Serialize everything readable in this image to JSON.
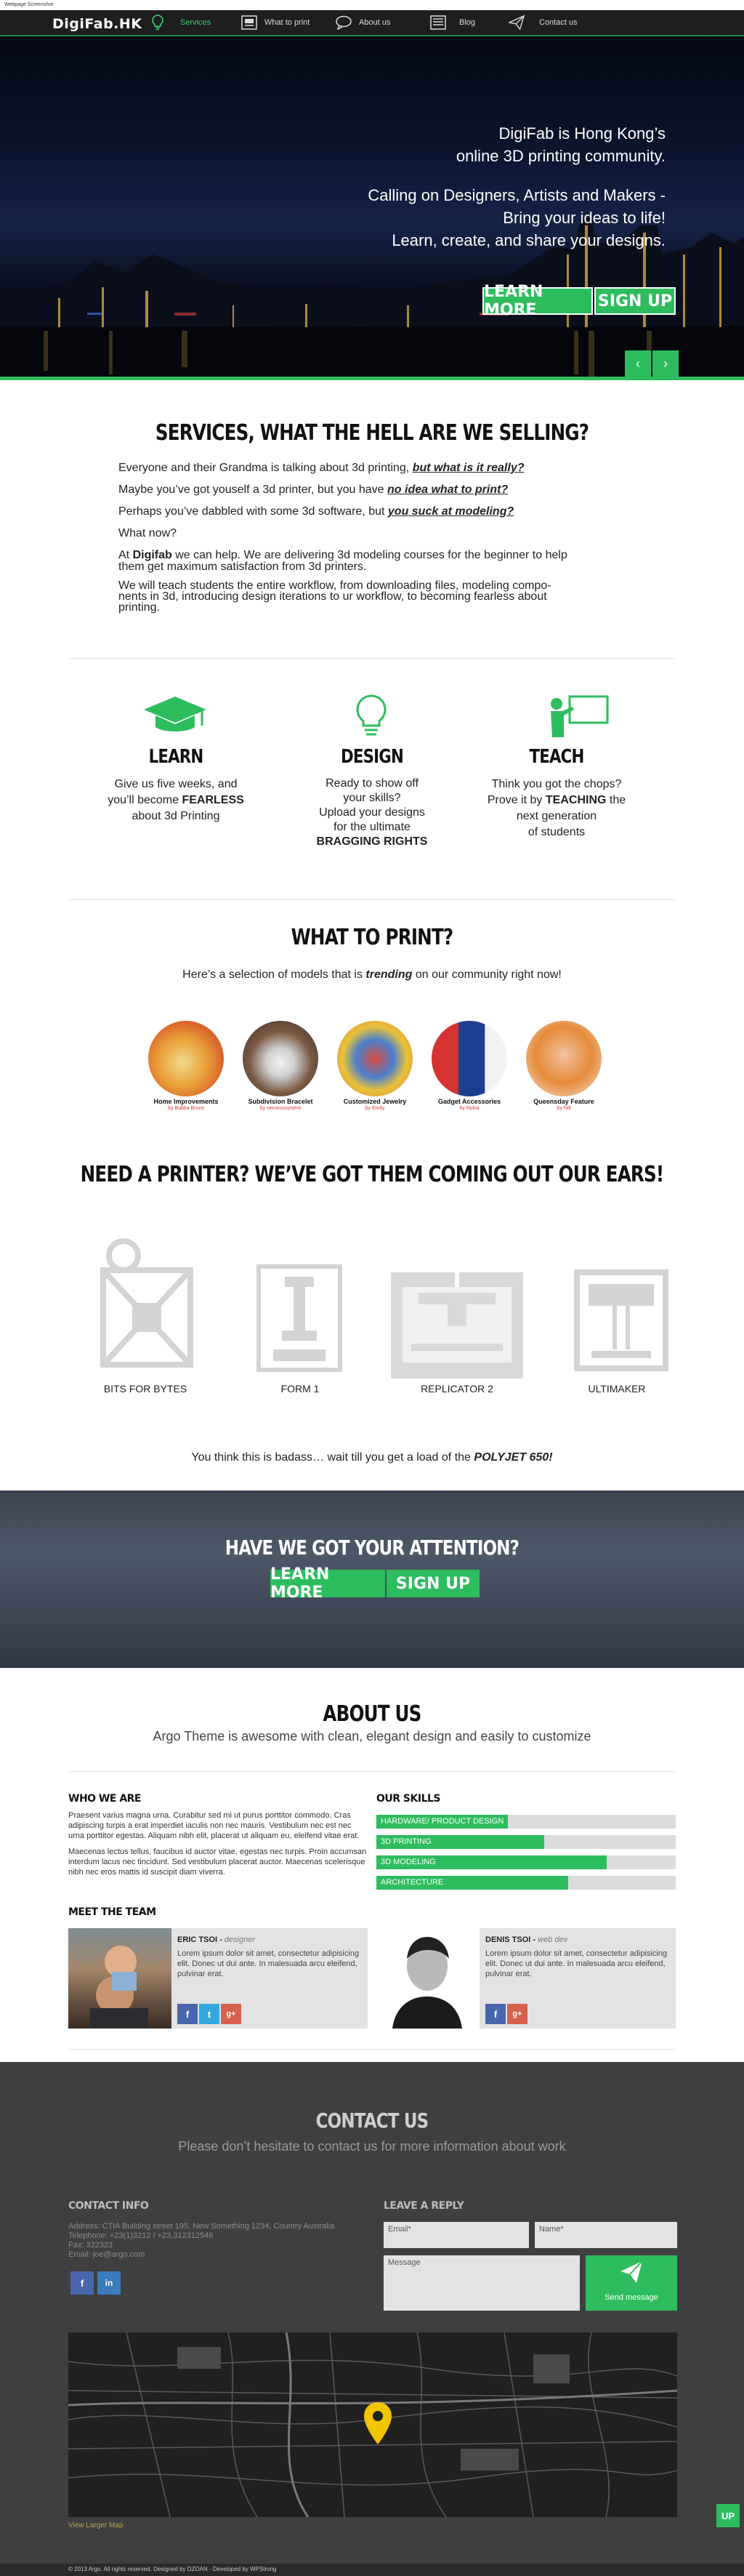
{
  "screenshot_label": "Webpage Screenshot",
  "nav": {
    "logo": "DigiFab.HK",
    "items": [
      {
        "label": "Services",
        "icon": "lightbulb-icon"
      },
      {
        "label": "What to print",
        "icon": "printer-icon"
      },
      {
        "label": "About us",
        "icon": "speech-bubble-icon"
      },
      {
        "label": "Blog",
        "icon": "newspaper-icon"
      },
      {
        "label": "Contact us",
        "icon": "paper-plane-icon"
      }
    ]
  },
  "hero": {
    "line1": "DigiFab is Hong Kong’s",
    "line2": "online 3D printing community.",
    "line3": "Calling on Designers, Artists and Makers -",
    "line4": "Bring your ideas to life!",
    "line5": "Learn, create, and share your designs.",
    "btn_learn": "LEARN MORE",
    "btn_signup": "SIGN UP",
    "prev": "‹",
    "next": "›"
  },
  "services": {
    "title": "SERVICES, WHAT THE HELL ARE WE SELLING?",
    "p1_a": "Everyone and their Grandma is talking about 3d printing,",
    "p1_b": "but what is it really?",
    "p2_a": "Maybe you’ve got youself a 3d printer, but you have",
    "p2_b": "no idea what to print?",
    "p3_a": "Perhaps you’ve dabbled with some 3d software, but",
    "p3_b": "you suck at modeling?",
    "p4": "What now?",
    "p5_a": "At",
    "p5_b": "Digifab",
    "p5_c": "we can help. We are delivering 3d modeling courses for the beginner to help",
    "p5_d": "them get maximum satisfaction from 3d printers.",
    "p6_1": "We will teach students the entire workflow, from downloading files, modeling compo-",
    "p6_2": "nents in 3d, introducing design iterations to ur workflow, to becoming fearless about",
    "p6_3": "printing."
  },
  "features": [
    {
      "title": "LEARN",
      "l1": "Give us five weeks, and",
      "l2a": "you’ll become",
      "l2b": "FEARLESS",
      "l3": "about 3d Printing",
      "icon": "graduation-cap-icon"
    },
    {
      "title": "DESIGN",
      "l1": "Ready to show off",
      "l2": "your skills?",
      "l3": "Upload your designs",
      "l4": "for the ultimate",
      "l5": "BRAGGING RIGHTS",
      "icon": "lightbulb-icon"
    },
    {
      "title": "TEACH",
      "l1": "Think you got the chops?",
      "l2a": "Prove it by",
      "l2b": "TEACHING",
      "l2c": "the",
      "l3": "next generation",
      "l4": "of students",
      "icon": "teacher-board-icon"
    }
  ],
  "print": {
    "title": "WHAT TO PRINT?",
    "sub_a": "Here’s a selection of models that is",
    "sub_b": "trending",
    "sub_c": "on our community right now!",
    "items": [
      {
        "name": "Home Improvements",
        "by": "by Bubba Bruce"
      },
      {
        "name": "Subdivision Bracelet",
        "by": "by nervoussystem"
      },
      {
        "name": "Customized Jewelry",
        "by": "by Emily"
      },
      {
        "name": "Gadget Accessories",
        "by": "by Nokia"
      },
      {
        "name": "Queensday Feature",
        "by": "by Nill"
      }
    ]
  },
  "printers": {
    "title": "NEED A PRINTER? WE’VE GOT THEM COMING OUT OUR EARS!",
    "items": [
      "BITS FOR BYTES",
      "FORM 1",
      "REPLICATOR 2",
      "ULTIMAKER"
    ],
    "footnote_a": "You think this is badass… wait till you get a load of the",
    "footnote_b": "POLYJET 650!"
  },
  "attention": {
    "title": "HAVE WE GOT YOUR ATTENTION?",
    "btn_learn": "LEARN MORE",
    "btn_signup": "SIGN UP"
  },
  "about": {
    "title": "ABOUT US",
    "subtitle": "Argo Theme is awesome with clean, elegant design and easily to customize",
    "who_title": "WHO WE ARE",
    "who_p1": "Praesent varius magna urna. Curabitur sed mi ut purus porttitor commodo. Cras adipiscing turpis a erat imperdiet iaculis non nec mauris. Vestibulum nec est nec urna porttitor egestas. Aliquam nibh elit, placerat ut aliquam eu, eleifend vitae erat.",
    "who_p2": "Maecenas lectus tellus, faucibus id auctor vitae, egestas nec turpis. Proin accumsan interdum lacus nec tincidunt. Sed vestibulum placerat auctor. Maecenas scelerisque nibh nec eros mattis id suscipit diam viverra.",
    "skills_title": "OUR SKILLS",
    "skills": [
      {
        "label": "HARDWARE/ PRODUCT DESIGN",
        "level": 0.44
      },
      {
        "label": "3D PRINTING",
        "level": 0.56
      },
      {
        "label": "3D MODELING",
        "level": 0.77
      },
      {
        "label": "ARCHITECTURE",
        "level": 0.64
      }
    ],
    "team_title": "MEET THE TEAM",
    "team": [
      {
        "name": "ERIC TSOI",
        "sep": " - ",
        "role": "designer",
        "bio": "Lorem ipsum dolor sit amet, consectetur adipisicing elit. Donec ut dui ante. In malesuada arcu eleifend, pulvinar erat."
      },
      {
        "name": "DENIS TSOI",
        "sep": " - ",
        "role": "web dev",
        "bio": "Lorem ipsum dolor sit amet, consectetur adipisicing elit. Donec ut dui ante. In malesuada arcu eleifend, pulvinar erat."
      }
    ],
    "social": {
      "facebook": "f",
      "twitter": "t",
      "google": "g+"
    }
  },
  "contact": {
    "title": "CONTACT US",
    "subtitle": "Please don’t hesitate to contact us for more information about work",
    "info_title": "CONTACT INFO",
    "address": "Address: CTIA Building street 195, New Something 1234, Country Australia",
    "telephone": "Telephone: +23(1)3212 / +23,312312546",
    "fax": "Fax: 322323",
    "email": "Email: joe@argo.com",
    "reply_title": "LEAVE A REPLY",
    "email_placeholder": "Email*",
    "name_placeholder": "Name*",
    "message_placeholder": "Message",
    "send_label": "Send message",
    "map_link": "View Larger Map",
    "up_label": "UP",
    "footer_a": "© 2013 Argo. All rights reserved. Designed by DZOAN - Developed by WPStrong"
  },
  "colors": {
    "accent": "#2dbd5e",
    "nav_bg": "#1e1e1e",
    "contact_bg": "#3f3f3f"
  }
}
